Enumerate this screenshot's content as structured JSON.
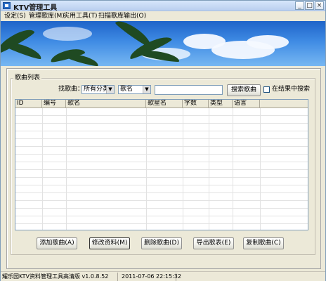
{
  "window": {
    "title": "KTV管理工具"
  },
  "menu": [
    "设定(S)",
    "管理歌库(M)",
    "实用工具(T)",
    "扫描歌库输出(O)"
  ],
  "window_buttons": {
    "minimize": "_",
    "maximize": "□",
    "close": "×"
  },
  "song_list": {
    "group_label": "歌曲列表",
    "find_label": "找歌曲：",
    "category_select": "所有分类",
    "field_select": "歌名",
    "search_value": "",
    "search_button": "搜索歌曲",
    "search_in_results_label": "在结果中搜索",
    "search_in_results_checked": false
  },
  "table": {
    "columns": [
      "ID",
      "编号",
      "歌名",
      "歌星名",
      "字数",
      "类型",
      "语言"
    ],
    "rows": 16
  },
  "actions": [
    "添加歌曲(A)",
    "修改资料(M)",
    "删除歌曲(D)",
    "导出歌表(E)",
    "复制歌曲(C)"
  ],
  "status": {
    "app": "耀乐园KTV资料管理工具高清版 v1.0.8.52",
    "datetime": "2011-07-06 22:15:32"
  }
}
